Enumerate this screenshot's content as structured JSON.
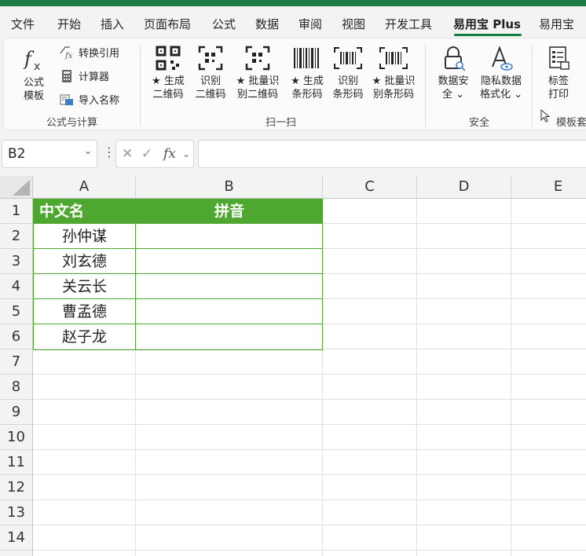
{
  "tabs": [
    {
      "label": "文件"
    },
    {
      "label": "开始"
    },
    {
      "label": "插入"
    },
    {
      "label": "页面布局"
    },
    {
      "label": "公式"
    },
    {
      "label": "数据"
    },
    {
      "label": "审阅"
    },
    {
      "label": "视图"
    },
    {
      "label": "开发工具"
    },
    {
      "label": "易用宝 Plus",
      "active": true
    },
    {
      "label": "易用宝"
    }
  ],
  "ribbon": {
    "formula_group": {
      "template_btn": {
        "line1": "公式",
        "line2": "模板",
        "icon": "fx-icon"
      },
      "convert_ref": {
        "label": "转换引用",
        "icon": "fx-convert-icon"
      },
      "calculator": {
        "label": "计算器",
        "icon": "calculator-icon"
      },
      "import_name": {
        "label": "导入名称",
        "icon": "import-name-icon"
      },
      "label": "公式与计算"
    },
    "scan_group": {
      "buttons": [
        {
          "line1": "★ 生成",
          "line2": "二维码",
          "icon": "qrcode-icon"
        },
        {
          "line1": "识别",
          "line2": "二维码",
          "icon": "qrcode-scan-icon"
        },
        {
          "line1": "★ 批量识",
          "line2": "别二维码",
          "icon": "qrcode-batch-icon"
        },
        {
          "line1": "★ 生成",
          "line2": "条形码",
          "icon": "barcode-icon"
        },
        {
          "line1": "识别",
          "line2": "条形码",
          "icon": "barcode-scan-icon"
        },
        {
          "line1": "★ 批量识",
          "line2": "别条形码",
          "icon": "barcode-batch-icon"
        }
      ],
      "label": "扫一扫"
    },
    "security_group": {
      "buttons": [
        {
          "line1": "数据安",
          "line2": "全",
          "icon": "lock-icon",
          "dropdown": "⌄"
        },
        {
          "line1": "隐私数据",
          "line2": "格式化",
          "icon": "privacy-format-icon",
          "dropdown": "⌄"
        }
      ],
      "label": "安全"
    },
    "label_group": {
      "button": {
        "line1": "标签",
        "line2": "打印",
        "icon": "label-print-icon"
      },
      "label": "模板套"
    }
  },
  "formula_bar": {
    "name_box": "B2",
    "fx": "fx"
  },
  "sheet": {
    "columns": [
      "A",
      "B",
      "C",
      "D",
      "E"
    ],
    "rows": [
      "1",
      "2",
      "3",
      "4",
      "5",
      "6",
      "7",
      "8",
      "9",
      "10",
      "11",
      "12",
      "13",
      "14"
    ],
    "table": {
      "headers": [
        "中文名",
        "拼音"
      ],
      "names": [
        "孙仲谋",
        "刘玄德",
        "关云长",
        "曹孟德",
        "赵子龙"
      ],
      "pinyin": [
        "",
        "",
        "",
        "",
        ""
      ]
    }
  },
  "colors": {
    "accent": "#107c41",
    "table_header": "#4ea72e"
  }
}
